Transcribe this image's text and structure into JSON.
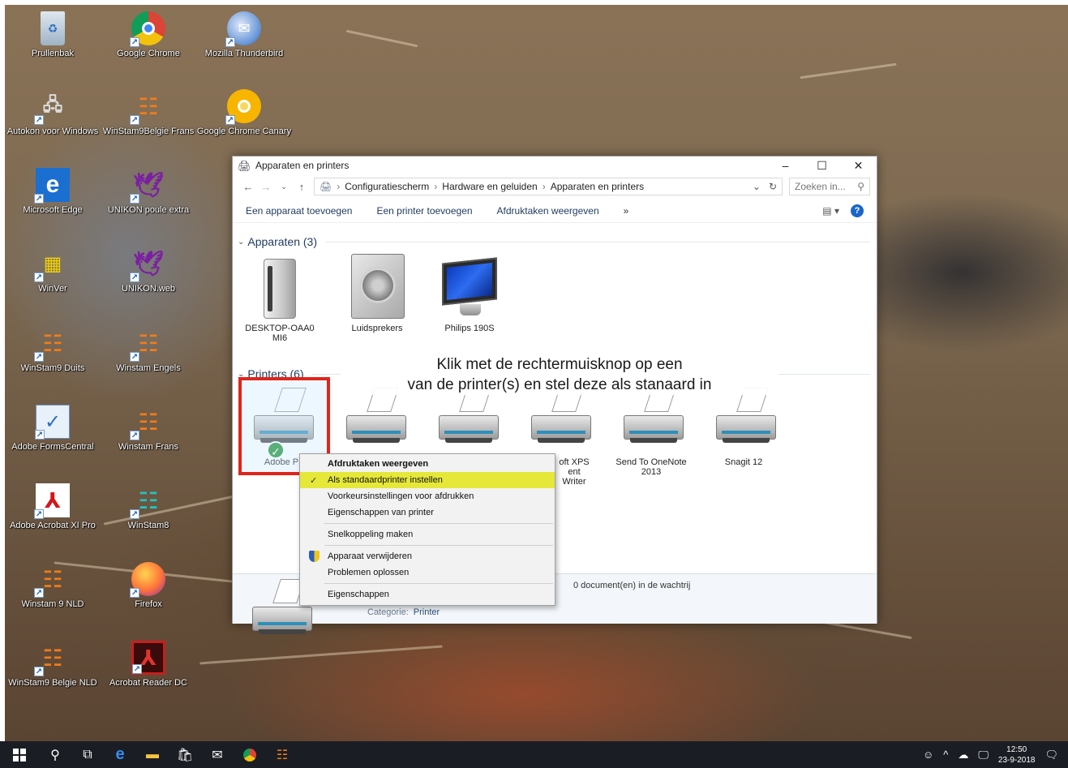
{
  "desktop": {
    "icons": [
      {
        "label": "Prullenbak",
        "icon": "recycle-bin-icon"
      },
      {
        "label": "Google Chrome",
        "icon": "chrome-icon"
      },
      {
        "label": "Mozilla Thunderbird",
        "icon": "thunderbird-icon"
      },
      {
        "label": "Autokon voor Windows",
        "icon": "autokon-icon"
      },
      {
        "label": "WinStam9Belgie Frans",
        "icon": "winstam-icon"
      },
      {
        "label": "Google Chrome Canary",
        "icon": "chrome-canary-icon"
      },
      {
        "label": "Microsoft Edge",
        "icon": "edge-icon"
      },
      {
        "label": "UNIKON poule extra",
        "icon": "unikon-icon"
      },
      {
        "label": "WinVer",
        "icon": "winver-icon"
      },
      {
        "label": "UNIKON.web",
        "icon": "unikon-web-icon"
      },
      {
        "label": "WinStam9 Duits",
        "icon": "winstam-icon"
      },
      {
        "label": "Winstam Engels",
        "icon": "winstam-icon"
      },
      {
        "label": "Adobe FormsCentral",
        "icon": "forms-central-icon"
      },
      {
        "label": "Winstam Frans",
        "icon": "winstam-icon"
      },
      {
        "label": "Adobe Acrobat XI Pro",
        "icon": "acrobat-icon"
      },
      {
        "label": "WinStam8",
        "icon": "winstam8-icon"
      },
      {
        "label": "Winstam 9 NLD",
        "icon": "winstam-icon"
      },
      {
        "label": "Firefox",
        "icon": "firefox-icon"
      },
      {
        "label": "WinStam9 Belgie NLD",
        "icon": "winstam-icon"
      },
      {
        "label": "Acrobat Reader DC",
        "icon": "acrobat-reader-icon"
      }
    ]
  },
  "window": {
    "title": "Apparaten en printers",
    "breadcrumb": [
      "Configuratiescherm",
      "Hardware en geluiden",
      "Apparaten en printers"
    ],
    "search_placeholder": "Zoeken in...",
    "toolbar": {
      "add_device": "Een apparaat toevoegen",
      "add_printer": "Een printer toevoegen",
      "print_jobs": "Afdruktaken weergeven",
      "more": "»"
    },
    "devices_header": "Apparaten (3)",
    "devices": [
      {
        "label": "DESKTOP-OAA0 MI6"
      },
      {
        "label": "Luidsprekers"
      },
      {
        "label": "Philips 190S"
      }
    ],
    "printers_header": "Printers (6)",
    "printers": [
      {
        "label": "Adobe P"
      },
      {
        "label": ""
      },
      {
        "label": ""
      },
      {
        "label": "oft XPS ent Writer"
      },
      {
        "label": "Send To OneNote 2013"
      },
      {
        "label": "Snagit 12"
      }
    ],
    "detail": {
      "queue": "0 document(en) in de wachtrij",
      "category_label": "Categorie:",
      "category_value": "Printer"
    }
  },
  "callout": {
    "line1": "Klik met de rechtermuisknop op een",
    "line2": "van de printer(s)  en stel deze als stanaard in"
  },
  "context_menu": {
    "items": [
      "Afdruktaken weergeven",
      "Als standaardprinter instellen",
      "Voorkeursinstellingen voor afdrukken",
      "Eigenschappen van printer",
      "Snelkoppeling maken",
      "Apparaat verwijderen",
      "Problemen oplossen",
      "Eigenschappen"
    ]
  },
  "taskbar": {
    "time": "12:50",
    "date": "23-9-2018"
  },
  "colors": {
    "highlight": "#e5e839",
    "selection_border": "#e0251b",
    "taskbar": "#1b1d24"
  }
}
